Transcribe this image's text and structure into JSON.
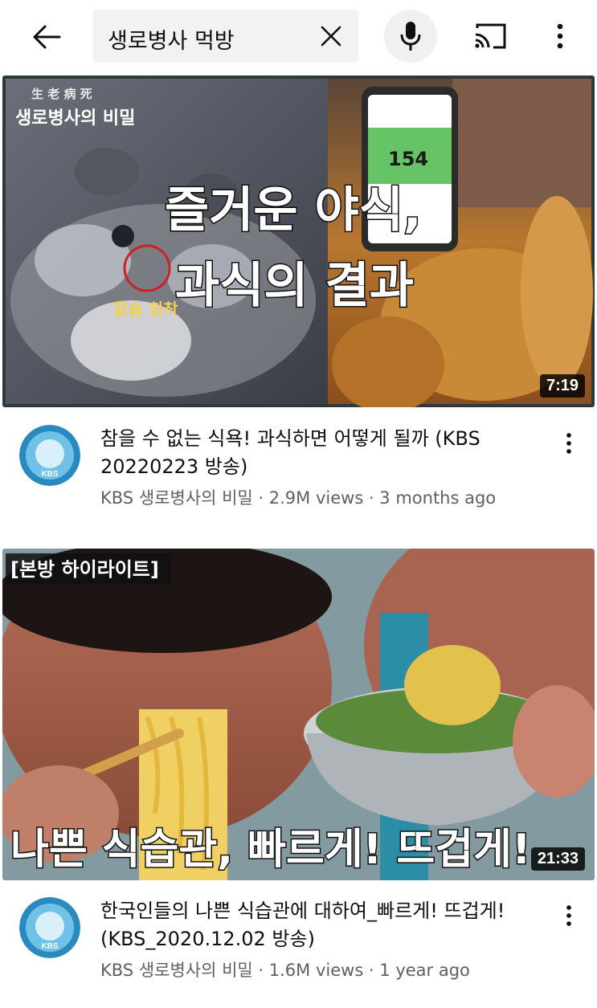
{
  "header": {
    "search_query": "생로병사 먹방",
    "icons": {
      "back": "arrow-left-icon",
      "clear": "close-icon",
      "mic": "mic-icon",
      "cast": "cast-icon",
      "more": "more-vert-icon"
    }
  },
  "videos": [
    {
      "title": "참을 수 없는 식욕! 과식하면 어떻게 될까 (KBS 20220223 방송)",
      "channel": "KBS 생로병사의 비밀",
      "views": "2.9M views",
      "age": "3 months ago",
      "duration": "7:19",
      "thumbnail": {
        "headline_line1": "즐거운 야식,",
        "headline_line2": "과식의 결과",
        "logo_hanja": "生 老 病 死",
        "logo_title": "생로병사의 비밀",
        "annotation": "칼슘 침착",
        "glucose_value": "154"
      }
    },
    {
      "title": "한국인들의 나쁜 식습관에 대하여_빠르게! 뜨겁게! (KBS_2020.12.02 방송)",
      "channel": "KBS 생로병사의 비밀",
      "views": "1.6M views",
      "age": "1 year ago",
      "duration": "21:33",
      "thumbnail": {
        "tag": "[본방 하이라이트]",
        "headline": "나쁜 식습관, 빠르게! 뜨겁게!"
      }
    }
  ],
  "avatar": {
    "label": "KBS",
    "color": "#1f7fb3"
  },
  "meta_separator": " · "
}
